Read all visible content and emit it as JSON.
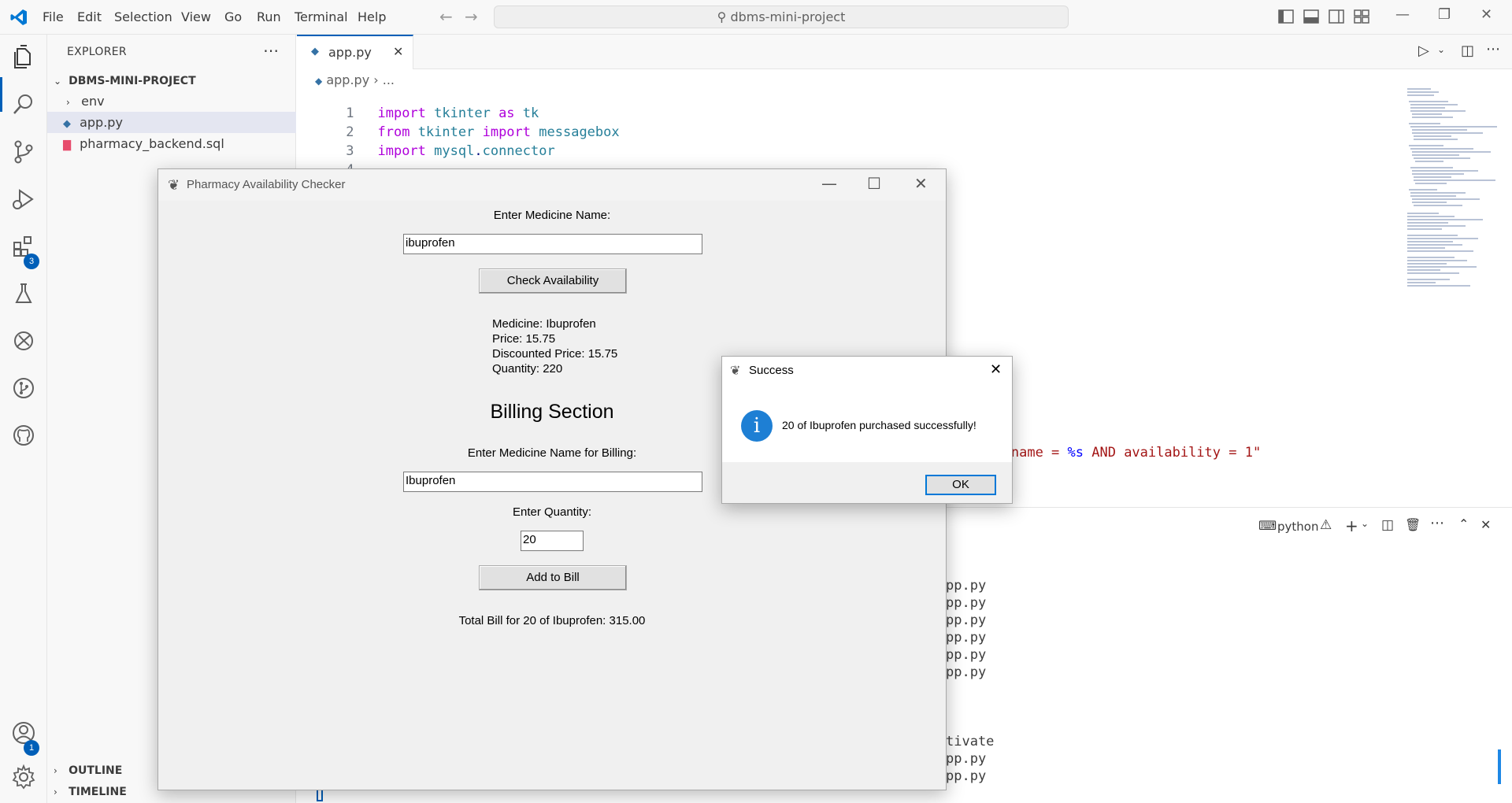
{
  "menu": [
    "File",
    "Edit",
    "Selection",
    "View",
    "Go",
    "Run",
    "Terminal",
    "Help"
  ],
  "command_center": "dbms-mini-project",
  "activity_badges": {
    "extensions": "3",
    "accounts": "1"
  },
  "sidebar": {
    "title": "EXPLORER",
    "project": "DBMS-MINI-PROJECT",
    "items": [
      "env",
      "app.py",
      "pharmacy_backend.sql"
    ],
    "outline": "OUTLINE",
    "timeline": "TIMELINE"
  },
  "editor": {
    "tab": "app.py",
    "breadcrumb_file": "app.py",
    "breadcrumb_rest": "...",
    "lines": [
      {
        "n": "1",
        "kw": "import",
        "a": "tkinter",
        "kw2": "as",
        "b": "tk"
      },
      {
        "n": "2",
        "kw": "from",
        "a": "tkinter",
        "kw2": "import",
        "b": "messagebox"
      },
      {
        "n": "3",
        "kw": "import",
        "a": "mysql",
        "b": "connector"
      },
      {
        "n": "4"
      }
    ],
    "sql_fragment_a": "s WHERE name = ",
    "sql_fragment_fmt": "%s",
    "sql_fragment_b": " AND availability = 1\""
  },
  "panel": {
    "shell": "python",
    "term_lines": [
      "pp.py",
      "pp.py",
      "pp.py",
      "pp.py",
      "pp.py",
      "pp.py",
      "tivate",
      "pp.py",
      "pp.py"
    ]
  },
  "tk": {
    "title": "Pharmacy Availability Checker",
    "medicine_label": "Enter Medicine Name:",
    "medicine_value": "ibuprofen",
    "check_button": "Check Availability",
    "result_name": "Medicine: Ibuprofen",
    "result_price": "Price: 15.75",
    "result_discount": "Discounted Price: 15.75",
    "result_qty": "Quantity: 220",
    "billing_title": "Billing Section",
    "billing_label": "Enter Medicine Name for Billing:",
    "billing_value": "Ibuprofen",
    "qty_label": "Enter Quantity:",
    "qty_value": "20",
    "add_button": "Add to Bill",
    "total": "Total Bill for 20 of Ibuprofen: 315.00"
  },
  "dialog": {
    "title": "Success",
    "message": "20 of Ibuprofen purchased successfully!",
    "ok": "OK"
  }
}
